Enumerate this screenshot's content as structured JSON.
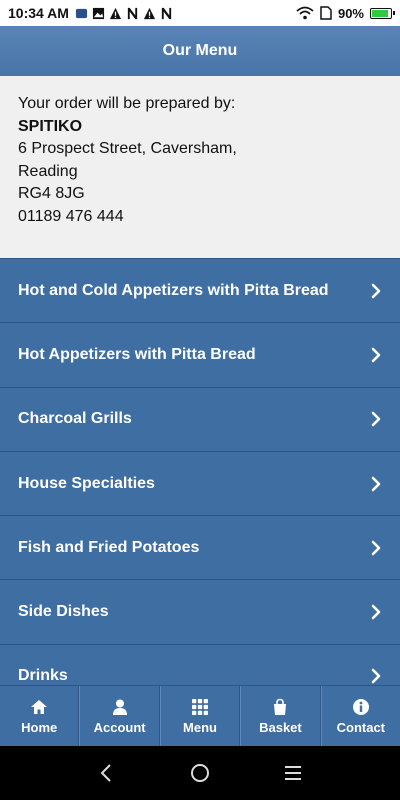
{
  "status_bar": {
    "time": "10:34 AM",
    "battery": "90%",
    "battery_level": 0.9
  },
  "header": {
    "title": "Our Menu"
  },
  "info": {
    "intro": "Your order will be prepared by:",
    "name": "SPITIKO",
    "address_line1": "6 Prospect Street, Caversham,",
    "address_line2": "Reading",
    "postcode": "RG4 8JG",
    "phone": "01189 476 444"
  },
  "menu": {
    "items": [
      {
        "label": "Hot and Cold Appetizers with Pitta Bread"
      },
      {
        "label": "Hot Appetizers with Pitta Bread"
      },
      {
        "label": "Charcoal Grills"
      },
      {
        "label": "House Specialties"
      },
      {
        "label": "Fish and Fried Potatoes"
      },
      {
        "label": "Side Dishes"
      },
      {
        "label": "Drinks"
      }
    ]
  },
  "tabs": [
    {
      "label": "Home",
      "icon": "home-icon"
    },
    {
      "label": "Account",
      "icon": "user-icon"
    },
    {
      "label": "Menu",
      "icon": "grid-icon"
    },
    {
      "label": "Basket",
      "icon": "basket-icon"
    },
    {
      "label": "Contact",
      "icon": "info-icon"
    }
  ],
  "colors": {
    "header": "#5a84b6",
    "menu_bg": "#3f6ea3",
    "info_bg": "#f0f0f0"
  }
}
